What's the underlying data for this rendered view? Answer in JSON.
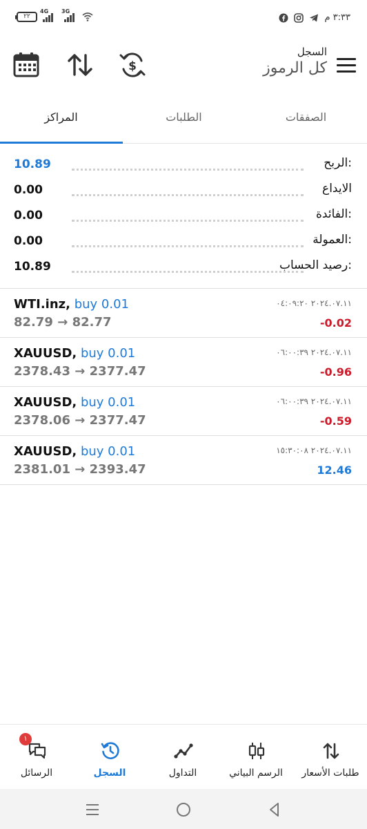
{
  "status_bar": {
    "time": "٣:٣٣ م",
    "battery": "٢٢",
    "net1": "4G",
    "net2": "3G"
  },
  "header": {
    "subtitle": "السجل",
    "title": "كل الرموز",
    "icons": [
      "calendar-icon",
      "sort-icon",
      "currency-exchange-icon",
      "menu-icon"
    ]
  },
  "tabs": [
    {
      "label": "الصفقات",
      "active": false
    },
    {
      "label": "الطلبات",
      "active": false
    },
    {
      "label": "المراكز",
      "active": true
    }
  ],
  "summary": [
    {
      "label": "الربح:",
      "value": "10.89",
      "highlight": true
    },
    {
      "label": "الايداع",
      "value": "0.00",
      "highlight": false
    },
    {
      "label": "الفائدة:",
      "value": "0.00",
      "highlight": false
    },
    {
      "label": "العمولة:",
      "value": "0.00",
      "highlight": false
    },
    {
      "label": "رصيد الحساب:",
      "value": "10.89",
      "highlight": false
    }
  ],
  "trades": [
    {
      "symbol": "WTI.inz,",
      "action": "buy 0.01",
      "open": "82.79",
      "close": "82.77",
      "datetime": "٢٠٢٤.٠٧.١١ ٠٤:٠٩:٢٠",
      "pl": "-0.02",
      "pl_sign": "neg"
    },
    {
      "symbol": "XAUUSD,",
      "action": "buy 0.01",
      "open": "2378.43",
      "close": "2377.47",
      "datetime": "٢٠٢٤.٠٧.١١ ٠٦:٠٠:٣٩",
      "pl": "-0.96",
      "pl_sign": "neg"
    },
    {
      "symbol": "XAUUSD,",
      "action": "buy 0.01",
      "open": "2378.06",
      "close": "2377.47",
      "datetime": "٢٠٢٤.٠٧.١١ ٠٦:٠٠:٣٩",
      "pl": "-0.59",
      "pl_sign": "neg"
    },
    {
      "symbol": "XAUUSD,",
      "action": "buy 0.01",
      "open": "2381.01",
      "close": "2393.47",
      "datetime": "٢٠٢٤.٠٧.١١ ١٥:٣٠:٠٨",
      "pl": "12.46",
      "pl_sign": "pos"
    }
  ],
  "arrow": "→",
  "bottom_nav": [
    {
      "label": "الرسائل",
      "icon": "messages-icon",
      "active": false,
      "badge": "١"
    },
    {
      "label": "السجل",
      "icon": "history-icon",
      "active": true
    },
    {
      "label": "التداول",
      "icon": "trade-icon",
      "active": false
    },
    {
      "label": "الرسم البياني",
      "icon": "chart-icon",
      "active": false
    },
    {
      "label": "طلبات الأسعار",
      "icon": "quotes-icon",
      "active": false
    }
  ],
  "colors": {
    "accent": "#1e7ad6",
    "loss": "#cc1a2a"
  }
}
